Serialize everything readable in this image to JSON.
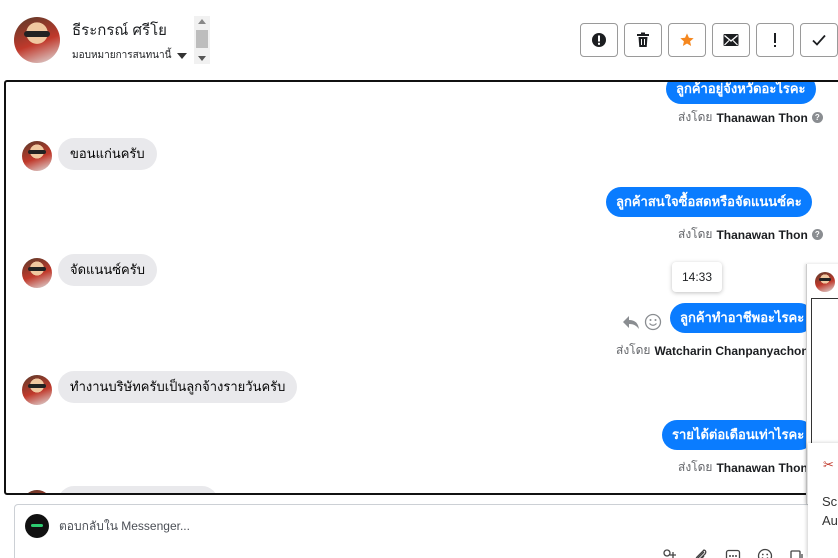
{
  "header": {
    "contact_name": "ธีระกรณ์ ศรีโย",
    "assign_label": "มอบหมายการสนทนานี้"
  },
  "toolbar": {
    "buttons": [
      {
        "name": "mark-spam-button",
        "icon": "exclamation-circle-icon"
      },
      {
        "name": "delete-button",
        "icon": "trash-icon"
      },
      {
        "name": "star-button",
        "icon": "star-icon",
        "color": "#f5871f"
      },
      {
        "name": "mark-unread-button",
        "icon": "envelope-icon"
      },
      {
        "name": "follow-up-button",
        "icon": "exclamation-icon"
      },
      {
        "name": "mark-done-button",
        "icon": "checkmark-icon"
      }
    ]
  },
  "conversation": {
    "sent_by_prefix": "ส่งโดย",
    "messages": [
      {
        "dir": "out",
        "text": "ลูกค้าอยู่จังหวัดอะไรคะ",
        "sender": "Thanawan Thon"
      },
      {
        "dir": "in",
        "text": "ขอนแก่นครับ"
      },
      {
        "dir": "out",
        "text": "ลูกค้าสนใจซื้อสดหรือจัดแนนซ์คะ",
        "sender": "Thanawan Thon"
      },
      {
        "dir": "in",
        "text": "จัดแนนซ์ครับ"
      },
      {
        "dir": "out",
        "text": "ลูกค้าทำอาชีพอะไรคะ",
        "sender": "Watcharin Chanpanyachon"
      },
      {
        "dir": "in",
        "text": "ทำงานบริษัทครับเป็นลูกจ้างรายวันครับ"
      },
      {
        "dir": "out",
        "text": "รายได้ต่อเดือนเท่าไรคะ",
        "sender": "Thanawan Thon"
      }
    ],
    "tooltip_time": "14:33"
  },
  "composer": {
    "placeholder": "ตอบกลับใน Messenger..."
  },
  "notification": {
    "line1": "Sc",
    "line2": "Au"
  },
  "colors": {
    "outgoing_bubble": "#0a7cff",
    "incoming_bubble": "#e9e9ec"
  }
}
